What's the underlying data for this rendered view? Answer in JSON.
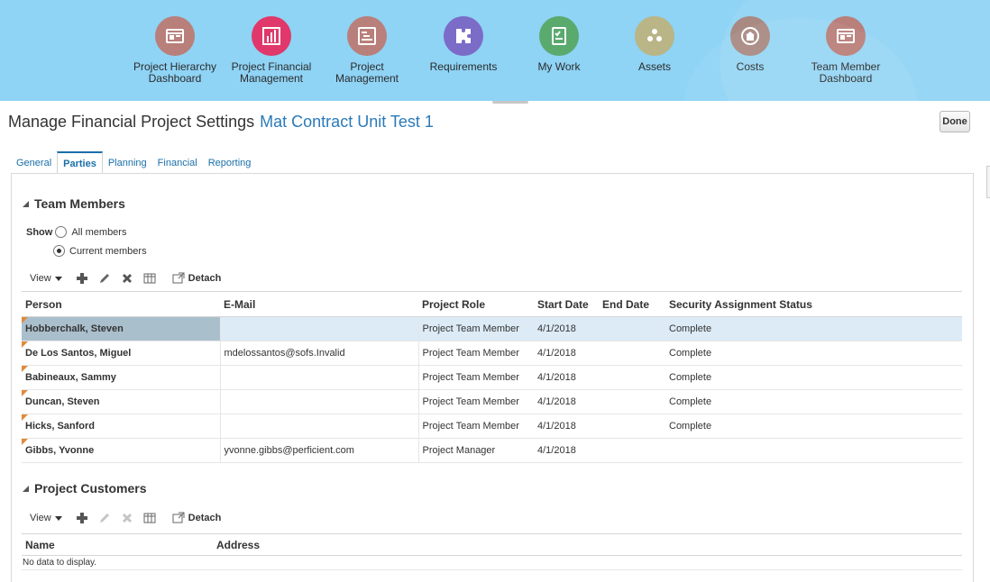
{
  "nav": {
    "items": [
      {
        "label": "Project Hierarchy Dashboard",
        "color": "#b97f7a",
        "icon": "dashboard-icon"
      },
      {
        "label": "Project Financial Management",
        "color": "#e0386a",
        "icon": "financial-chart-icon"
      },
      {
        "label": "Project Management",
        "color": "#b97f7a",
        "icon": "gantt-icon"
      },
      {
        "label": "Requirements",
        "color": "#7b6cc8",
        "icon": "puzzle-icon"
      },
      {
        "label": "My Work",
        "color": "#5aaa6e",
        "icon": "checklist-icon"
      },
      {
        "label": "Assets",
        "color": "#b9b586",
        "icon": "assets-icon"
      },
      {
        "label": "Costs",
        "color": "#a88a82",
        "icon": "costs-icon"
      },
      {
        "label": "Team Member Dashboard",
        "color": "#b97f7a",
        "icon": "dashboard-icon"
      }
    ]
  },
  "header": {
    "title": "Manage Financial Project Settings",
    "project": "Mat Contract Unit Test 1",
    "done_label": "Done"
  },
  "tabs": [
    {
      "label": "General",
      "active": false
    },
    {
      "label": "Parties",
      "active": true
    },
    {
      "label": "Planning",
      "active": false
    },
    {
      "label": "Financial",
      "active": false
    },
    {
      "label": "Reporting",
      "active": false
    }
  ],
  "team": {
    "section_title": "Team Members",
    "show_label": "Show",
    "option_all": "All members",
    "option_current": "Current members",
    "selected_option": "Current members",
    "toolbar": {
      "view_label": "View",
      "detach_label": "Detach"
    },
    "columns": [
      "Person",
      "E-Mail",
      "Project Role",
      "Start Date",
      "End Date",
      "Security Assignment Status"
    ],
    "rows": [
      {
        "person": "Hobberchalk, Steven",
        "email": "",
        "role": "Project Team Member",
        "start": "4/1/2018",
        "end": "",
        "status": "Complete"
      },
      {
        "person": "De Los Santos, Miguel",
        "email": "mdelossantos@sofs.Invalid",
        "role": "Project Team Member",
        "start": "4/1/2018",
        "end": "",
        "status": "Complete"
      },
      {
        "person": "Babineaux, Sammy",
        "email": "",
        "role": "Project Team Member",
        "start": "4/1/2018",
        "end": "",
        "status": "Complete"
      },
      {
        "person": "Duncan, Steven",
        "email": "",
        "role": "Project Team Member",
        "start": "4/1/2018",
        "end": "",
        "status": "Complete"
      },
      {
        "person": "Hicks, Sanford",
        "email": "",
        "role": "Project Team Member",
        "start": "4/1/2018",
        "end": "",
        "status": "Complete"
      },
      {
        "person": "Gibbs, Yvonne",
        "email": "yvonne.gibbs@perficient.com",
        "role": "Project Manager",
        "start": "4/1/2018",
        "end": "",
        "status": ""
      }
    ]
  },
  "customers": {
    "section_title": "Project Customers",
    "toolbar": {
      "view_label": "View",
      "detach_label": "Detach"
    },
    "columns": [
      "Name",
      "Address"
    ],
    "empty_text": "No data to display."
  }
}
